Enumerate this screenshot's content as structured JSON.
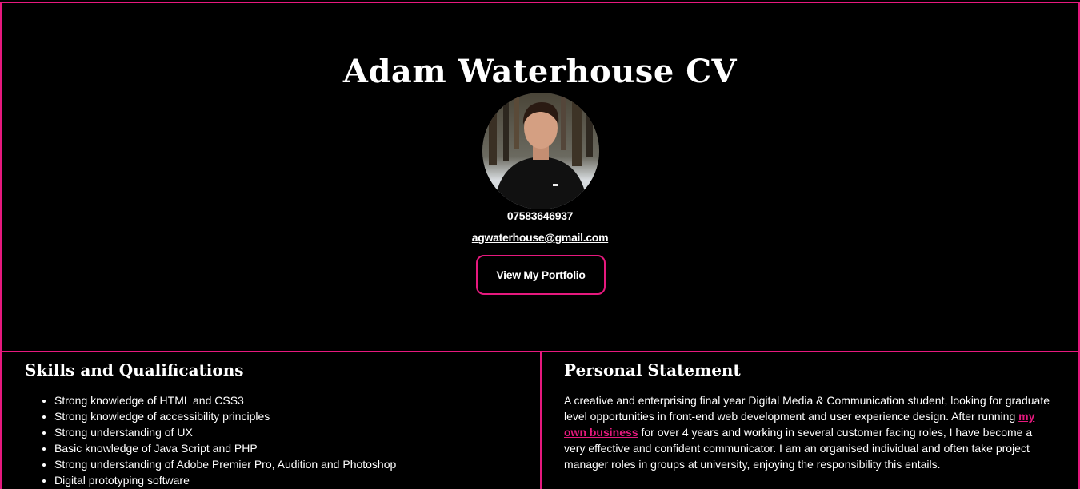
{
  "header": {
    "title": "Adam Waterhouse CV",
    "phone": "07583646937",
    "email": "agwaterhouse@gmail.com",
    "portfolio_button": "View My Portfolio"
  },
  "skills": {
    "heading": "Skills and Qualifications",
    "items": [
      "Strong knowledge of HTML and CSS3",
      "Strong knowledge of accessibility principles",
      "Strong understanding of UX",
      "Basic knowledge of Java Script and PHP",
      "Strong understanding of Adobe Premier Pro, Audition and Photoshop",
      "Digital prototyping software"
    ]
  },
  "statement": {
    "heading": "Personal Statement",
    "text_before": "A creative and enterprising final year Digital Media & Communication student, looking for graduate level opportunities in front-end web development and user experience design. After running ",
    "link": "my own business",
    "text_after": " for over 4 years and working in several customer facing roles, I have become a very effective and confident communicator. I am an organised individual and often take project manager roles in groups at university, enjoying the responsibility this entails."
  },
  "colors": {
    "accent": "#e6197e",
    "background": "#000000",
    "text": "#ffffff"
  }
}
